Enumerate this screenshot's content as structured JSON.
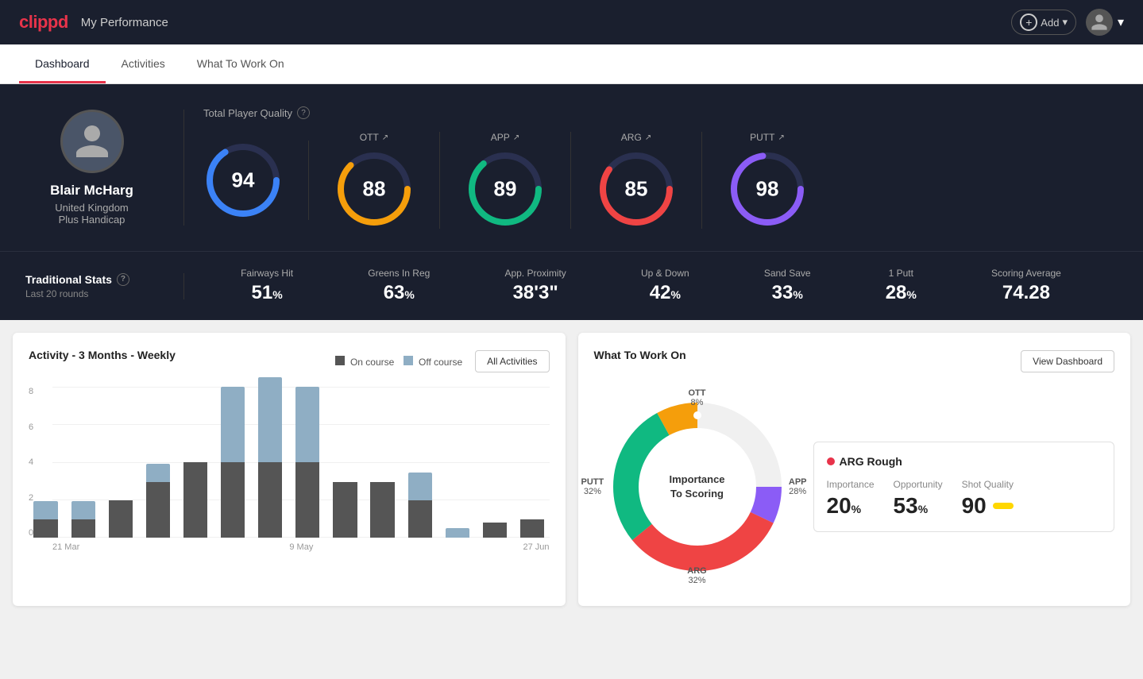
{
  "header": {
    "logo": "clippd",
    "title": "My Performance",
    "add_button_label": "Add",
    "chevron": "▾"
  },
  "nav": {
    "tabs": [
      {
        "label": "Dashboard",
        "active": true
      },
      {
        "label": "Activities",
        "active": false
      },
      {
        "label": "What To Work On",
        "active": false
      }
    ]
  },
  "player": {
    "name": "Blair McHarg",
    "country": "United Kingdom",
    "handicap": "Plus Handicap"
  },
  "total_quality": {
    "label": "Total Player Quality",
    "main_score": "94",
    "main_color": "#3b82f6",
    "categories": [
      {
        "key": "OTT",
        "label": "OTT",
        "score": "88",
        "color": "#f59e0b",
        "pct": 88
      },
      {
        "key": "APP",
        "label": "APP",
        "score": "89",
        "color": "#10b981",
        "pct": 89
      },
      {
        "key": "ARG",
        "label": "ARG",
        "score": "85",
        "color": "#ef4444",
        "pct": 85
      },
      {
        "key": "PUTT",
        "label": "PUTT",
        "score": "98",
        "color": "#8b5cf6",
        "pct": 98
      }
    ]
  },
  "traditional_stats": {
    "title": "Traditional Stats",
    "subtitle": "Last 20 rounds",
    "stats": [
      {
        "label": "Fairways Hit",
        "value": "51",
        "unit": "%"
      },
      {
        "label": "Greens In Reg",
        "value": "63",
        "unit": "%"
      },
      {
        "label": "App. Proximity",
        "value": "38'3\"",
        "unit": ""
      },
      {
        "label": "Up & Down",
        "value": "42",
        "unit": "%"
      },
      {
        "label": "Sand Save",
        "value": "33",
        "unit": "%"
      },
      {
        "label": "1 Putt",
        "value": "28",
        "unit": "%"
      },
      {
        "label": "Scoring Average",
        "value": "74.28",
        "unit": ""
      }
    ]
  },
  "activity_chart": {
    "title": "Activity - 3 Months - Weekly",
    "legend": [
      {
        "label": "On course",
        "color": "#555"
      },
      {
        "label": "Off course",
        "color": "#8faec4"
      }
    ],
    "all_activities_label": "All Activities",
    "y_axis": [
      "8",
      "6",
      "4",
      "2",
      "0"
    ],
    "x_labels": [
      "21 Mar",
      "9 May",
      "27 Jun"
    ],
    "bars": [
      {
        "on": 1,
        "off": 1
      },
      {
        "on": 1,
        "off": 1
      },
      {
        "on": 2,
        "off": 0
      },
      {
        "on": 3,
        "off": 1
      },
      {
        "on": 4,
        "off": 0
      },
      {
        "on": 4,
        "off": 4
      },
      {
        "on": 4,
        "off": 4.5
      },
      {
        "on": 4,
        "off": 4
      },
      {
        "on": 3,
        "off": 0
      },
      {
        "on": 3,
        "off": 0
      },
      {
        "on": 2,
        "off": 1.5
      },
      {
        "on": 0,
        "off": 0.5
      },
      {
        "on": 0.8,
        "off": 0
      },
      {
        "on": 1,
        "off": 0
      }
    ]
  },
  "what_to_work_on": {
    "title": "What To Work On",
    "view_dashboard_label": "View Dashboard",
    "donut_center_line1": "Importance",
    "donut_center_line2": "To Scoring",
    "segments": [
      {
        "label": "OTT",
        "value": "8%",
        "color": "#f59e0b",
        "pct": 8
      },
      {
        "label": "APP",
        "value": "28%",
        "color": "#10b981",
        "pct": 28
      },
      {
        "label": "ARG",
        "value": "32%",
        "color": "#ef4444",
        "pct": 32
      },
      {
        "label": "PUTT",
        "value": "32%",
        "color": "#8b5cf6",
        "pct": 32
      }
    ],
    "detail_card": {
      "category": "ARG Rough",
      "metrics": [
        {
          "label": "Importance",
          "value": "20%"
        },
        {
          "label": "Opportunity",
          "value": "53%"
        },
        {
          "label": "Shot Quality",
          "value": "90"
        }
      ]
    }
  }
}
